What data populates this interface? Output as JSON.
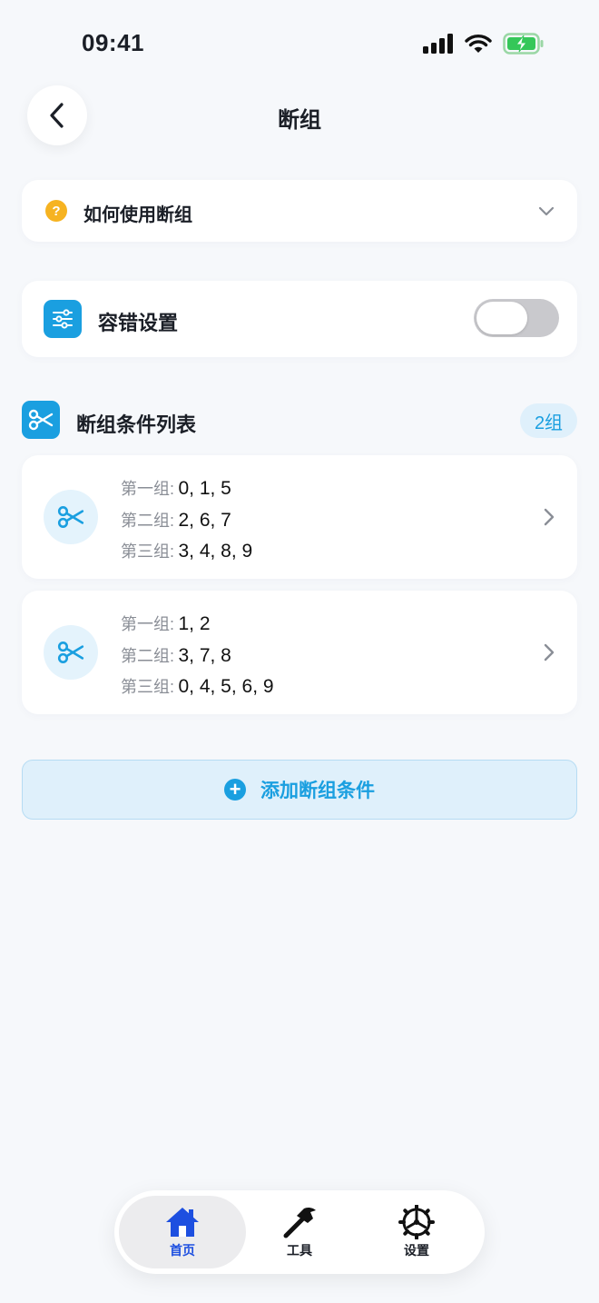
{
  "status_bar": {
    "time": "09:41"
  },
  "header": {
    "title": "断组"
  },
  "help": {
    "icon": "?",
    "label": "如何使用断组"
  },
  "tolerance": {
    "label": "容错设置",
    "enabled": false
  },
  "section": {
    "title": "断组条件列表",
    "count": "2组"
  },
  "groups": [
    {
      "rows": [
        {
          "label": "第一组:",
          "value": "0, 1, 5"
        },
        {
          "label": "第二组:",
          "value": "2, 6, 7"
        },
        {
          "label": "第三组:",
          "value": "3, 4, 8, 9"
        }
      ]
    },
    {
      "rows": [
        {
          "label": "第一组:",
          "value": "1, 2"
        },
        {
          "label": "第二组:",
          "value": "3, 7, 8"
        },
        {
          "label": "第三组:",
          "value": "0, 4, 5, 6, 9"
        }
      ]
    }
  ],
  "add_button": {
    "icon": "+",
    "label": "添加断组条件"
  },
  "tabs": [
    {
      "label": "首页",
      "icon": "home-icon",
      "active": true
    },
    {
      "label": "工具",
      "icon": "hammer-icon",
      "active": false
    },
    {
      "label": "设置",
      "icon": "gear-icon",
      "active": false
    }
  ],
  "colors": {
    "accent": "#1a9fe0",
    "tab_active": "#1d4fe0",
    "help_icon": "#f6b321",
    "background": "#f6f8fb"
  }
}
